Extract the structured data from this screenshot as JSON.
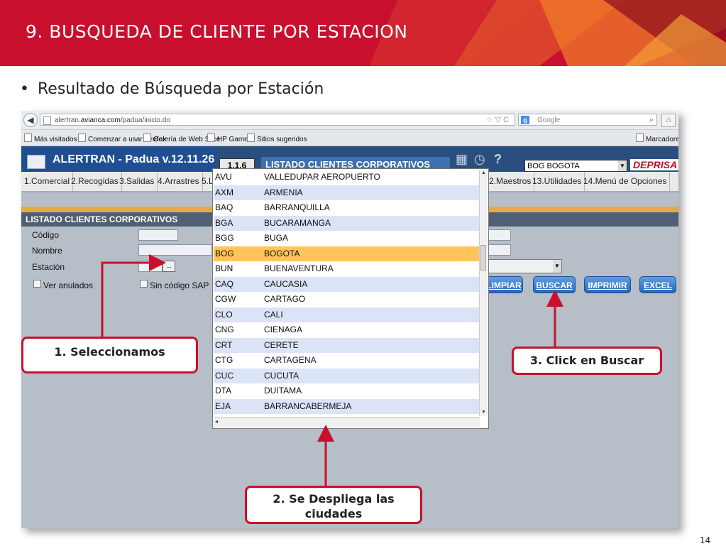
{
  "slide": {
    "title": "9.  BUSQUEDA DE CLIENTE POR ESTACION",
    "bullet": "Resultado de  Búsqueda por  Estación",
    "page_number": "14",
    "accent_color": "#c8102e"
  },
  "browser": {
    "url_domain_prefix": "alertran.",
    "url_domain": "avianca.com",
    "url_path": "/padua/inicio.do",
    "search_placeholder": "Google",
    "bookmarks": [
      "Más visitados",
      "Comenzar a usar Firefox",
      "Galería de Web Slice",
      "HP Games",
      "Sitios sugeridos"
    ],
    "bookmarks_menu": "Marcadores"
  },
  "app": {
    "title": "ALERTRAN - Padua  v.12.11.26",
    "version": "1.1.6",
    "section_title": "LISTADO CLIENTES CORPORATIVOS",
    "station_value": "BOG BOGOTA",
    "brand": "DEPRISA",
    "menu": [
      "1.Comercial",
      "2.Recogidas",
      "3.Salidas",
      "4.Arrastres",
      "5.L",
      "2.Maestros",
      "13.Utilidades",
      "14.Menú de Opciones"
    ]
  },
  "form": {
    "title": "LISTADO CLIENTES CORPORATIVOS",
    "codigo_label": "Código",
    "nombre_label": "Nombre",
    "estacion_label": "Estación",
    "lookup_label": "...",
    "ver_anulados": "Ver anulados",
    "sin_codigo_sap": "Sin código SAP",
    "buttons": {
      "limpiar": "LIMPIAR",
      "buscar": "BUSCAR",
      "imprimir": "IMPRIMIR",
      "excel": "EXCEL"
    }
  },
  "dropdown": {
    "selected_code": "BOG",
    "cities": [
      {
        "code": "AVU",
        "name": "VALLEDUPAR AEROPUERTO"
      },
      {
        "code": "AXM",
        "name": "ARMENIA"
      },
      {
        "code": "BAQ",
        "name": "BARRANQUILLA"
      },
      {
        "code": "BGA",
        "name": "BUCARAMANGA"
      },
      {
        "code": "BGG",
        "name": "BUGA"
      },
      {
        "code": "BOG",
        "name": "BOGOTA"
      },
      {
        "code": "BUN",
        "name": "BUENAVENTURA"
      },
      {
        "code": "CAQ",
        "name": "CAUCASIA"
      },
      {
        "code": "CGW",
        "name": "CARTAGO"
      },
      {
        "code": "CLO",
        "name": "CALI"
      },
      {
        "code": "CNG",
        "name": "CIENAGA"
      },
      {
        "code": "CRT",
        "name": "CERETE"
      },
      {
        "code": "CTG",
        "name": "CARTAGENA"
      },
      {
        "code": "CUC",
        "name": "CUCUTA"
      },
      {
        "code": "DTA",
        "name": "DUITAMA"
      },
      {
        "code": "EJA",
        "name": "BARRANCABERMEJA"
      }
    ]
  },
  "callouts": {
    "step1": "1. Seleccionamos",
    "step2": "2. Se Despliega las ciudades",
    "step3": "3. Click en Buscar"
  }
}
